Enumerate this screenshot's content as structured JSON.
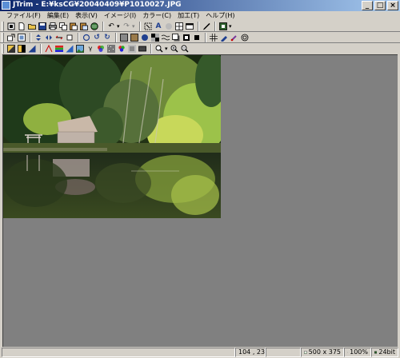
{
  "window": {
    "title": "JTrim - E:¥ksCG¥20040409¥P1010027.JPG",
    "minimize": "_",
    "maximize": "□",
    "close": "×"
  },
  "menu": {
    "items": [
      "ファイル(F)",
      "編集(E)",
      "表示(V)",
      "イメージ(I)",
      "カラー(C)",
      "加工(T)",
      "ヘルプ(H)"
    ]
  },
  "toolbar1": {
    "undo_glyph": "↶",
    "redo_glyph": "↷",
    "text_glyph": "A"
  },
  "toolbar2": {
    "rotate_left_glyph": "↺",
    "rotate_right_glyph": "↻"
  },
  "status": {
    "message": "",
    "cursor_pos": "104 , 23",
    "blank": "",
    "image_size": "500 x 375",
    "zoom": "100%",
    "color_depth": "24bit"
  },
  "colors": {
    "workspace_bg": "#808080",
    "chrome_bg": "#d4d0c8",
    "title_start": "#0a246a",
    "title_end": "#a6caf0"
  }
}
